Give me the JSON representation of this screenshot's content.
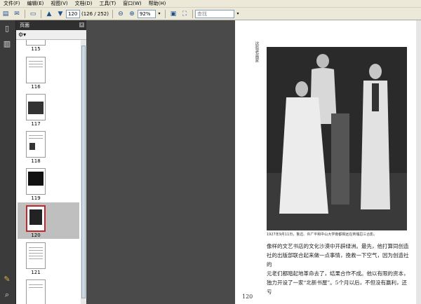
{
  "menu": [
    "文件(F)",
    "编辑(E)",
    "视图(V)",
    "文档(D)",
    "工具(T)",
    "窗口(W)",
    "帮助(H)"
  ],
  "toolbar": {
    "page_input": "120",
    "page_total": "(126 / 252)",
    "zoom": "92%",
    "search_placeholder": "查找"
  },
  "panel": {
    "title": "页面",
    "thumbnails": [
      "115",
      "116",
      "117",
      "118",
      "119",
      "120",
      "121"
    ],
    "selected": "120"
  },
  "page": {
    "vertical_title": "这些老画家",
    "caption": "1927年9月11日，鲁迅、许广平和中山大学旁都相远在蒋瑞忍三合影。",
    "body_lines": [
      "像样的文艺书店的文化沙漠中开辟绿洲。最先，他打算同创造",
      "社的出版部联合起来做一点事情，挽救一下空气，因为创造社的",
      "元老们都暗起地革命去了，结果合作不成。他以有限的资本，",
      "独力开设了一家“北新书屋”。5个月以后，不但没有赢利，还亏"
    ],
    "page_number": "120"
  }
}
